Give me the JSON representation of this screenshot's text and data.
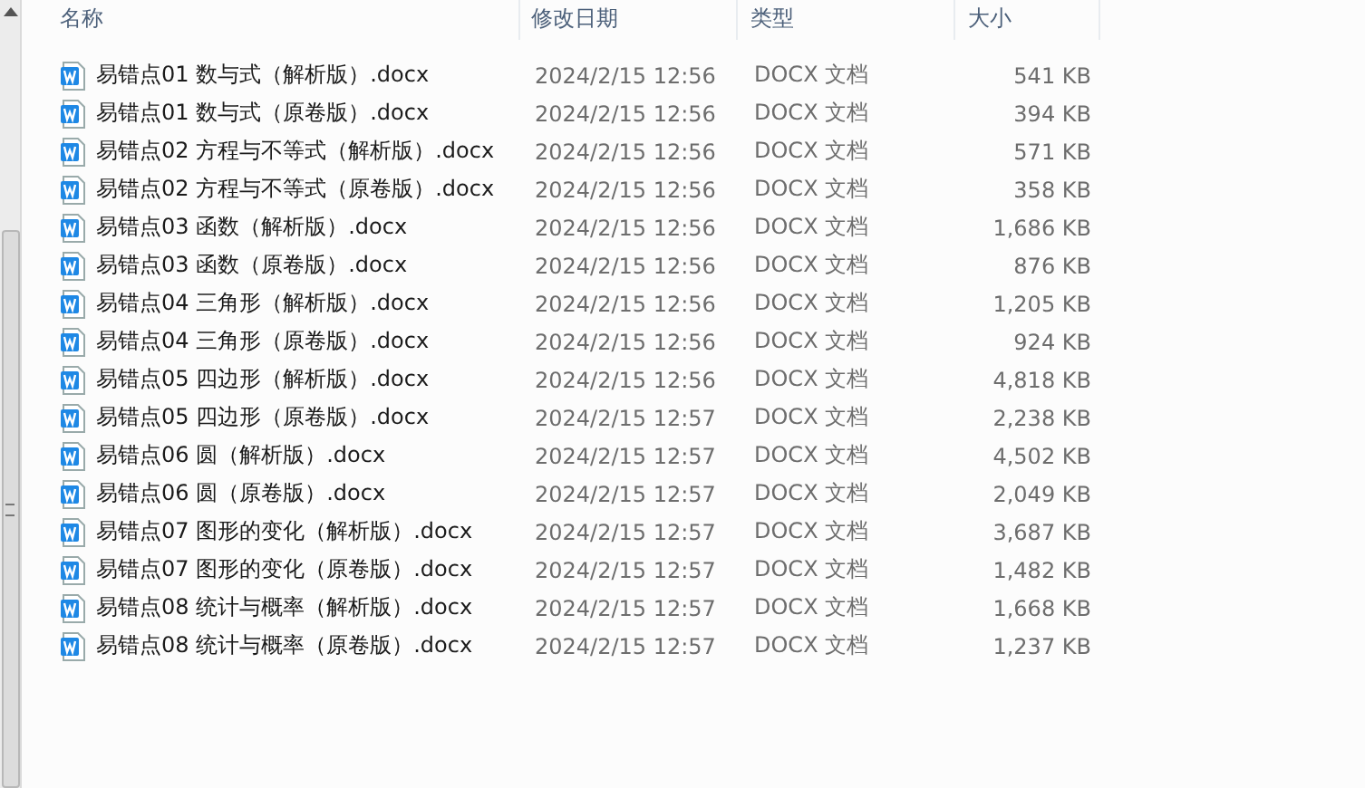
{
  "columns": [
    "名称",
    "修改日期",
    "类型",
    "大小"
  ],
  "files": [
    {
      "name": "易错点01 数与式（解析版）.docx",
      "modified": "2024/2/15 12:56",
      "type": "DOCX 文档",
      "size": "541 KB"
    },
    {
      "name": "易错点01 数与式（原卷版）.docx",
      "modified": "2024/2/15 12:56",
      "type": "DOCX 文档",
      "size": "394 KB"
    },
    {
      "name": "易错点02 方程与不等式（解析版）.docx",
      "modified": "2024/2/15 12:56",
      "type": "DOCX 文档",
      "size": "571 KB"
    },
    {
      "name": "易错点02 方程与不等式（原卷版）.docx",
      "modified": "2024/2/15 12:56",
      "type": "DOCX 文档",
      "size": "358 KB"
    },
    {
      "name": "易错点03 函数（解析版）.docx",
      "modified": "2024/2/15 12:56",
      "type": "DOCX 文档",
      "size": "1,686 KB"
    },
    {
      "name": "易错点03 函数（原卷版）.docx",
      "modified": "2024/2/15 12:56",
      "type": "DOCX 文档",
      "size": "876 KB"
    },
    {
      "name": "易错点04 三角形（解析版）.docx",
      "modified": "2024/2/15 12:56",
      "type": "DOCX 文档",
      "size": "1,205 KB"
    },
    {
      "name": "易错点04 三角形（原卷版）.docx",
      "modified": "2024/2/15 12:56",
      "type": "DOCX 文档",
      "size": "924 KB"
    },
    {
      "name": "易错点05 四边形（解析版）.docx",
      "modified": "2024/2/15 12:56",
      "type": "DOCX 文档",
      "size": "4,818 KB"
    },
    {
      "name": "易错点05 四边形（原卷版）.docx",
      "modified": "2024/2/15 12:57",
      "type": "DOCX 文档",
      "size": "2,238 KB"
    },
    {
      "name": "易错点06 圆（解析版）.docx",
      "modified": "2024/2/15 12:57",
      "type": "DOCX 文档",
      "size": "4,502 KB"
    },
    {
      "name": "易错点06 圆（原卷版）.docx",
      "modified": "2024/2/15 12:57",
      "type": "DOCX 文档",
      "size": "2,049 KB"
    },
    {
      "name": "易错点07 图形的变化（解析版）.docx",
      "modified": "2024/2/15 12:57",
      "type": "DOCX 文档",
      "size": "3,687 KB"
    },
    {
      "name": "易错点07 图形的变化（原卷版）.docx",
      "modified": "2024/2/15 12:57",
      "type": "DOCX 文档",
      "size": "1,482 KB"
    },
    {
      "name": "易错点08 统计与概率（解析版）.docx",
      "modified": "2024/2/15 12:57",
      "type": "DOCX 文档",
      "size": "1,668 KB"
    },
    {
      "name": "易错点08 统计与概率（原卷版）.docx",
      "modified": "2024/2/15 12:57",
      "type": "DOCX 文档",
      "size": "1,237 KB"
    }
  ]
}
